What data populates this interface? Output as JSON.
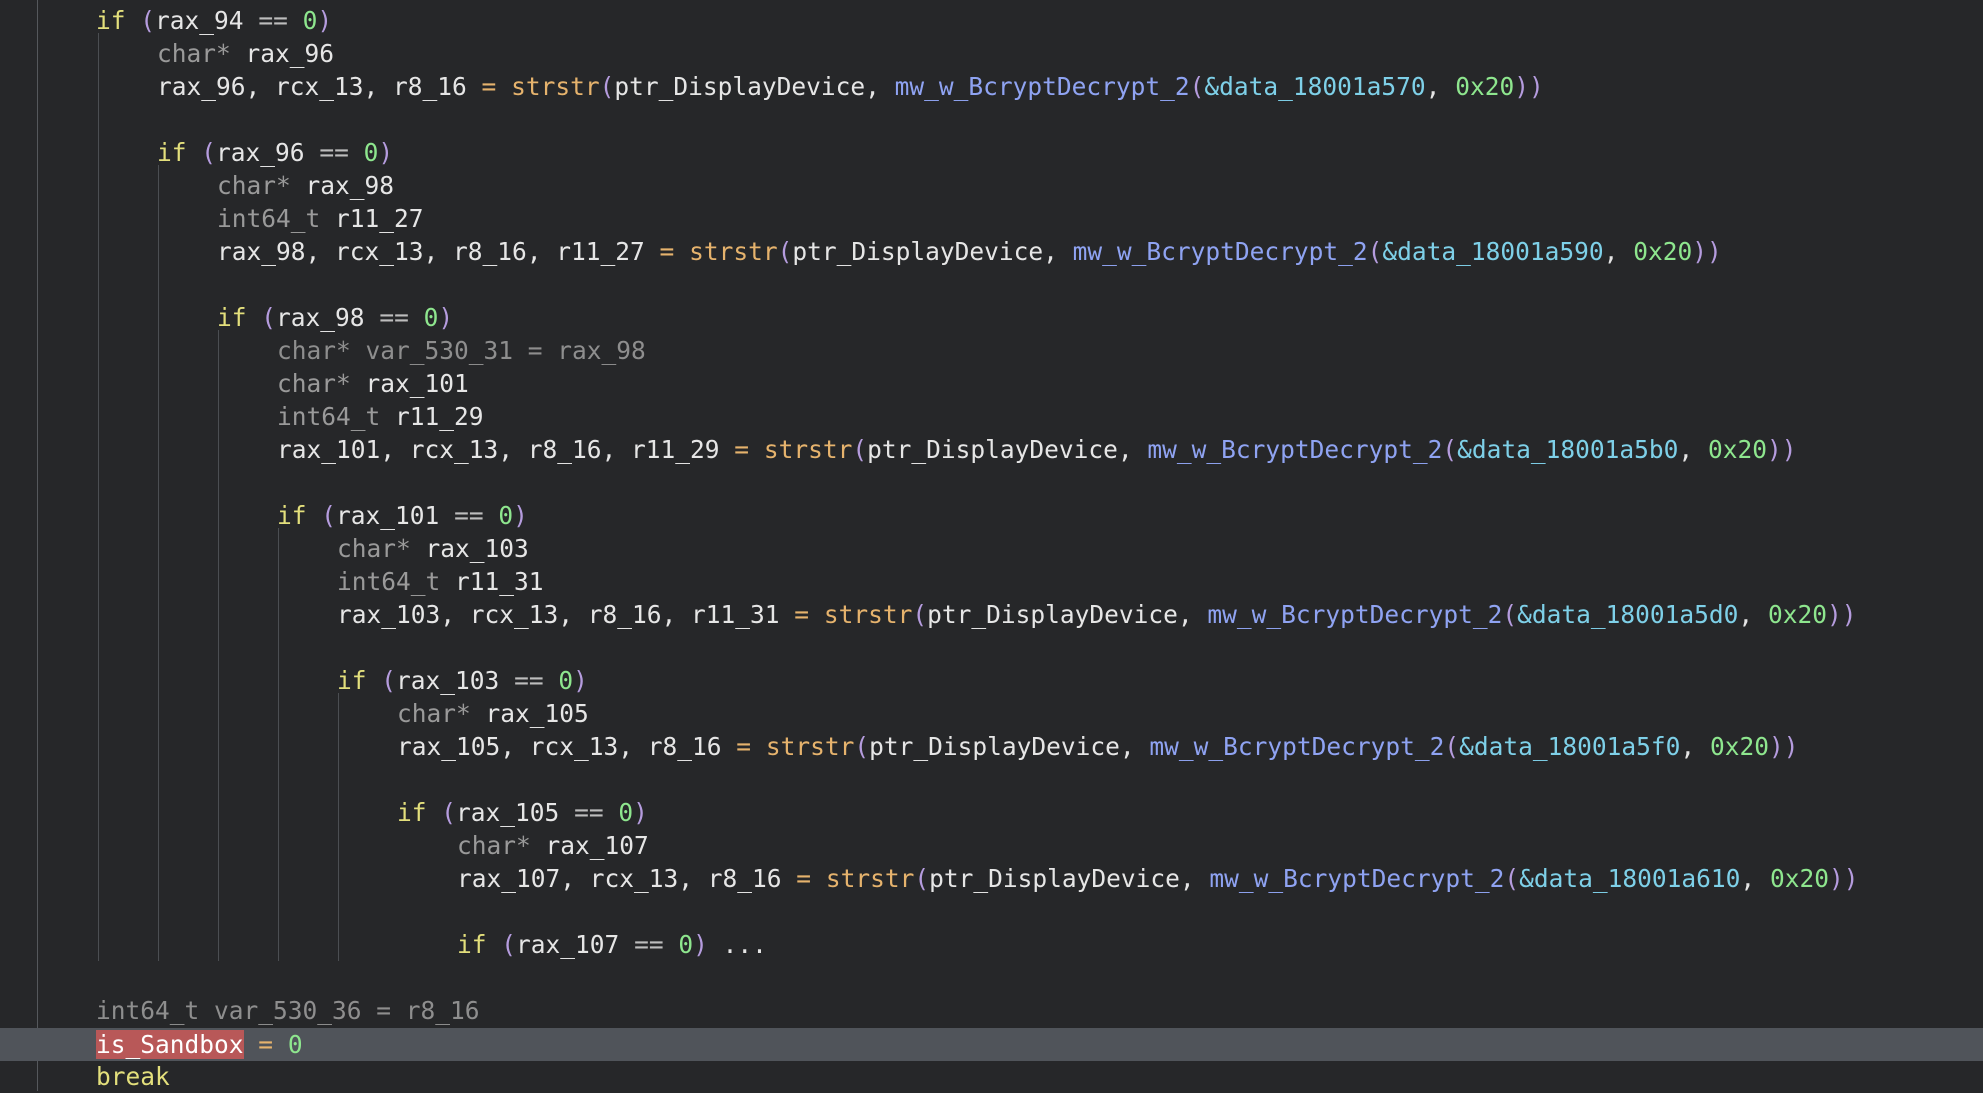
{
  "colors": {
    "background": "#262729",
    "keyword": "#e3df7c",
    "type": "#9a9a9a",
    "variable": "#e6e6e6",
    "number": "#8ee68e",
    "strstr": "#e6b36d",
    "call": "#8fa3f2",
    "data_symbol": "#7ed0e8",
    "highlighted_line": "#50545a",
    "flag_highlight": "#b85858"
  },
  "code": {
    "line1": {
      "kw": "if",
      "var": "rax_94",
      "cmp": "==",
      "num": "0"
    },
    "line2": {
      "type": "char*",
      "var": "rax_96"
    },
    "line3": {
      "lhs": "rax_96, rcx_13, r8_16",
      "eq": "=",
      "fn": "strstr",
      "arg1": "ptr_DisplayDevice",
      "call": "mw_w_BcryptDecrypt_2",
      "data": "&data_18001a570",
      "num": "0x20"
    },
    "line5": {
      "kw": "if",
      "var": "rax_96",
      "cmp": "==",
      "num": "0"
    },
    "line6": {
      "type": "char*",
      "var": "rax_98"
    },
    "line7": {
      "type": "int64_t",
      "var": "r11_27"
    },
    "line8": {
      "lhs": "rax_98, rcx_13, r8_16, r11_27",
      "eq": "=",
      "fn": "strstr",
      "arg1": "ptr_DisplayDevice",
      "call": "mw_w_BcryptDecrypt_2",
      "data": "&data_18001a590",
      "num": "0x20"
    },
    "line10": {
      "kw": "if",
      "var": "rax_98",
      "cmp": "==",
      "num": "0"
    },
    "line11": {
      "text": "char* var_530_31 = rax_98"
    },
    "line12": {
      "type": "char*",
      "var": "rax_101"
    },
    "line13": {
      "type": "int64_t",
      "var": "r11_29"
    },
    "line14": {
      "lhs": "rax_101, rcx_13, r8_16, r11_29",
      "eq": "=",
      "fn": "strstr",
      "arg1": "ptr_DisplayDevice",
      "call": "mw_w_BcryptDecrypt_2",
      "data": "&data_18001a5b0",
      "num": "0x20"
    },
    "line16": {
      "kw": "if",
      "var": "rax_101",
      "cmp": "==",
      "num": "0"
    },
    "line17": {
      "type": "char*",
      "var": "rax_103"
    },
    "line18": {
      "type": "int64_t",
      "var": "r11_31"
    },
    "line19": {
      "lhs": "rax_103, rcx_13, r8_16, r11_31",
      "eq": "=",
      "fn": "strstr",
      "arg1": "ptr_DisplayDevice",
      "call": "mw_w_BcryptDecrypt_2",
      "data": "&data_18001a5d0",
      "num": "0x20"
    },
    "line21": {
      "kw": "if",
      "var": "rax_103",
      "cmp": "==",
      "num": "0"
    },
    "line22": {
      "type": "char*",
      "var": "rax_105"
    },
    "line23": {
      "lhs": "rax_105, rcx_13, r8_16",
      "eq": "=",
      "fn": "strstr",
      "arg1": "ptr_DisplayDevice",
      "call": "mw_w_BcryptDecrypt_2",
      "data": "&data_18001a5f0",
      "num": "0x20"
    },
    "line25": {
      "kw": "if",
      "var": "rax_105",
      "cmp": "==",
      "num": "0"
    },
    "line26": {
      "type": "char*",
      "var": "rax_107"
    },
    "line27": {
      "lhs": "rax_107, rcx_13, r8_16",
      "eq": "=",
      "fn": "strstr",
      "arg1": "ptr_DisplayDevice",
      "call": "mw_w_BcryptDecrypt_2",
      "data": "&data_18001a610",
      "num": "0x20"
    },
    "line29": {
      "kw": "if",
      "var": "rax_107",
      "cmp": "==",
      "num": "0",
      "ellipsis": "..."
    },
    "line31": {
      "text": "int64_t var_530_36 = r8_16"
    },
    "line32": {
      "var": "is_Sandbox",
      "eq": "=",
      "num": "0"
    },
    "line33": {
      "kw": "break"
    }
  }
}
